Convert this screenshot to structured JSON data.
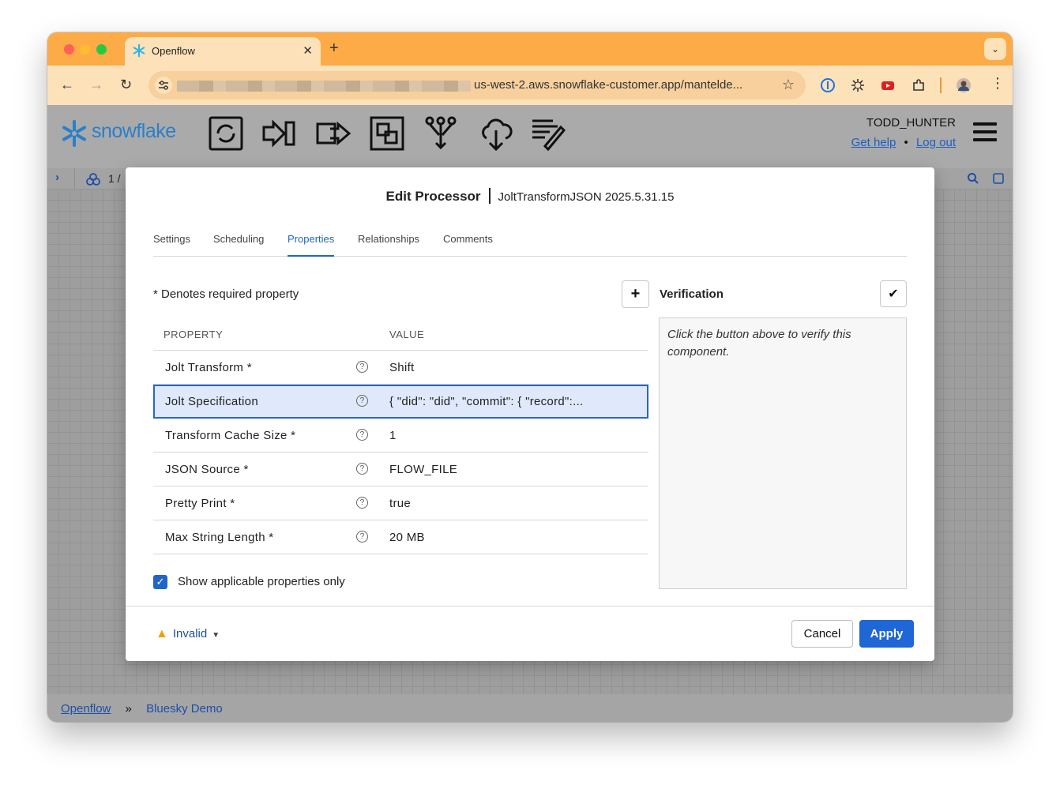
{
  "browser": {
    "tab_title": "Openflow",
    "url": "us-west-2.aws.snowflake-customer.app/mantelde..."
  },
  "app": {
    "logo": "snowflake",
    "toolbar_icons": [
      "processor-icon",
      "input-port-icon",
      "output-port-icon",
      "process-group-icon",
      "funnel-icon",
      "remote-process-group-icon",
      "label-icon"
    ],
    "username": "TODD_HUNTER",
    "get_help": "Get help",
    "separator": "•",
    "logout": "Log out",
    "crumb_page": "1 /"
  },
  "dialog": {
    "title": "Edit Processor",
    "subtitle": "JoltTransformJSON 2025.5.31.15",
    "tabs": [
      {
        "label": "Settings",
        "active": false
      },
      {
        "label": "Scheduling",
        "active": false
      },
      {
        "label": "Properties",
        "active": true
      },
      {
        "label": "Relationships",
        "active": false
      },
      {
        "label": "Comments",
        "active": false
      }
    ],
    "required_note": "* Denotes required property",
    "table": {
      "col_property": "PROPERTY",
      "col_value": "VALUE",
      "rows": [
        {
          "name": "Jolt Transform *",
          "value": "Shift"
        },
        {
          "name": "Jolt Specification",
          "value": "{ \"did\": \"did\", \"commit\": { \"record\":..."
        },
        {
          "name": "Transform Cache Size *",
          "value": "1"
        },
        {
          "name": "JSON Source *",
          "value": "FLOW_FILE"
        },
        {
          "name": "Pretty Print *",
          "value": "true"
        },
        {
          "name": "Max String Length *",
          "value": "20 MB"
        }
      ]
    },
    "show_applicable": "Show applicable properties only",
    "verification_title": "Verification",
    "verification_hint": "Click the button above to verify this component.",
    "status": "Invalid",
    "cancel": "Cancel",
    "apply": "Apply"
  },
  "footer": {
    "root_link": "Openflow",
    "sep": "»",
    "current": "Bluesky Demo"
  },
  "colors": {
    "chrome_orange": "#fdab46",
    "accent_blue": "#1f66c7",
    "selected_row": "#dfe9fb",
    "warning": "#f2a007"
  }
}
